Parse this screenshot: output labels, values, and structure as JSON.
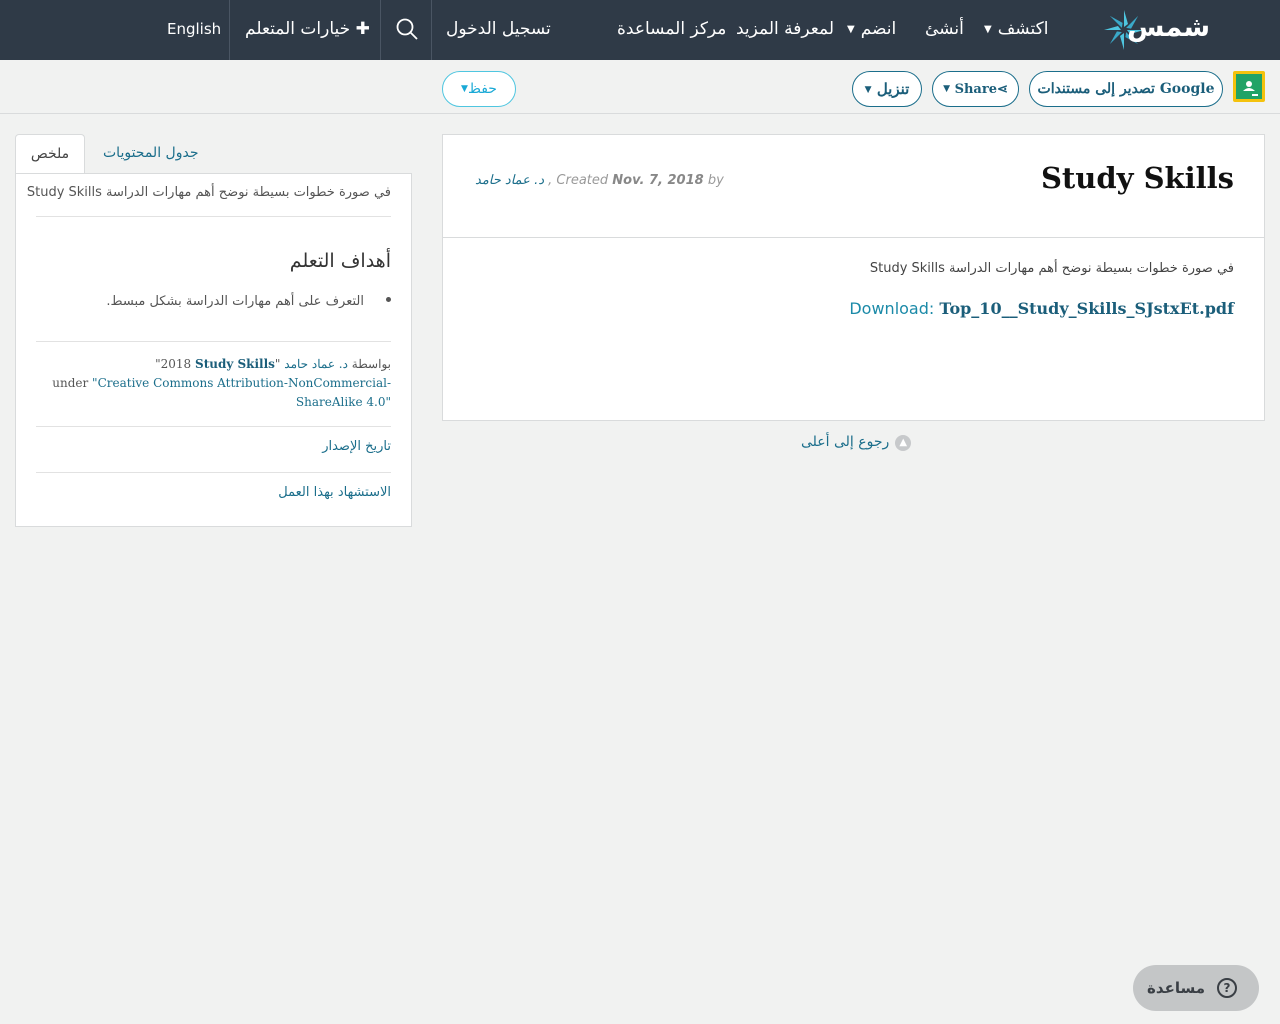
{
  "nav": {
    "logo_text": "شمس",
    "explore": "اكتشف",
    "create": "أنشئ",
    "join": "انضم",
    "learn_more": "لمعرفة المزيد",
    "help_center": "مركز المساعدة",
    "login": "تسجيل الدخول",
    "learner_options": "خيارات المتعلم",
    "language": "English"
  },
  "toolbar": {
    "export_google": "تصدير إلى مستندات Google",
    "share": "Share",
    "download": "تنزيل",
    "save": "حفظ"
  },
  "sidebar": {
    "tab_summary": "ملخص",
    "tab_toc": "جدول المحتويات",
    "summary_text": "في صورة خطوات بسيطة نوضح أهم مهارات الدراسة Study Skills",
    "objectives_heading": "أهداف التعلم",
    "objectives": [
      "التعرف على أهم مهارات الدراسة بشكل مبسط."
    ],
    "license": {
      "quote_open": "\"",
      "year": "2018",
      "title": "Study Skills",
      "by_word": "بواسطة",
      "author": "د. عماد حامد",
      "under": "under",
      "license_name": "\"Creative Commons Attribution-NonCommercial-ShareAlike 4.0\""
    },
    "version_history": "تاريخ الإصدار",
    "cite": "الاستشهاد بهذا العمل"
  },
  "main": {
    "title": "Study Skills",
    "meta_by": "by",
    "meta_date": "Nov. 7, 2018",
    "meta_created": "Created",
    "meta_author": "د. عماد حامد",
    "description": "في صورة خطوات بسيطة نوضح أهم مهارات  الدراسة Study Skills",
    "download_label": "Download:",
    "download_file": "Top_10__Study_Skills_SJstxEt.pdf",
    "back_to_top": "رجوع إلى أعلى"
  },
  "help": {
    "label": "مساعدة"
  },
  "colors": {
    "nav_bg": "#2f3a47",
    "link": "#1b6e8b",
    "accent": "#4fc6e0",
    "page_bg": "#f1f2f1"
  }
}
